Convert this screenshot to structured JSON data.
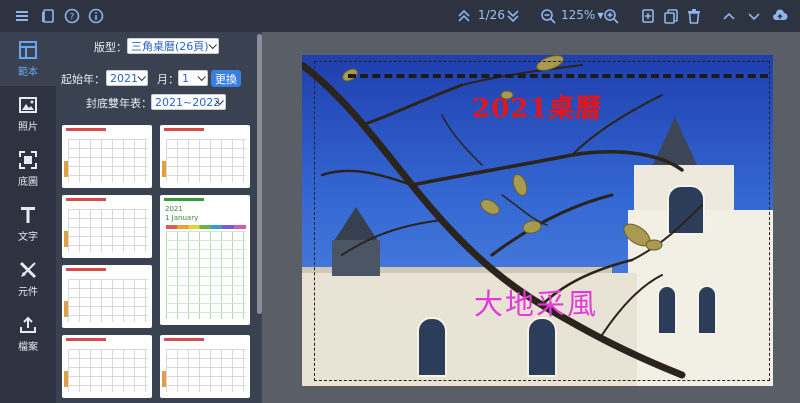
{
  "toolbar": {
    "page_indicator": "1/26",
    "zoom": "125%"
  },
  "nav": {
    "items": [
      {
        "label": "範本",
        "icon": "template-icon"
      },
      {
        "label": "照片",
        "icon": "photo-icon"
      },
      {
        "label": "底圖",
        "icon": "background-icon"
      },
      {
        "label": "文字",
        "icon": "text-icon"
      },
      {
        "label": "元件",
        "icon": "elements-icon"
      },
      {
        "label": "檔案",
        "icon": "file-upload-icon"
      }
    ]
  },
  "panel": {
    "format_label": "版型：",
    "format_value": "三角桌曆(26頁)",
    "start_year_label": "起始年：",
    "start_year_value": "2021",
    "month_label": "月：",
    "month_value": "1",
    "change_button": "更換",
    "back_cover_label": "封底雙年表：",
    "back_cover_value": "2021~2022",
    "template_thumb_title": "2021",
    "template_thumb_month": "1 January"
  },
  "canvas": {
    "title": "2021桌曆",
    "subtitle": "大地采風"
  },
  "colors": {
    "toolbar_bg": "#2d3341",
    "panel_bg": "#3a4151",
    "accent": "#3a7fe0",
    "icon_blue": "#8fb4e8",
    "title_red": "#e0161c",
    "subtitle_magenta": "#e23bd8"
  }
}
